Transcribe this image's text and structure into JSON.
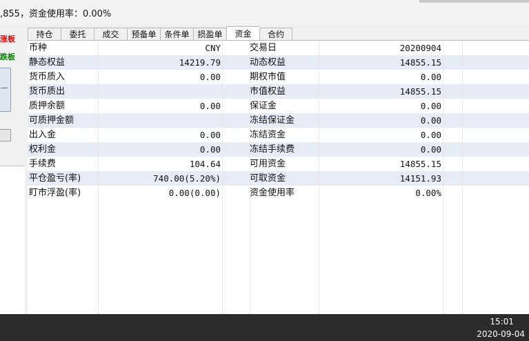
{
  "topbar": {
    "summary": ",855，资金使用率：0.00%"
  },
  "leftpanel": {
    "limit_up_label": "涨板",
    "limit_down_label": "跌板"
  },
  "tabs": [
    {
      "label": "持仓"
    },
    {
      "label": "委托"
    },
    {
      "label": "成交"
    },
    {
      "label": "预备单"
    },
    {
      "label": "条件单"
    },
    {
      "label": "损盈单"
    },
    {
      "label": "资金",
      "active": true
    },
    {
      "label": "合约"
    }
  ],
  "funds": {
    "rows": [
      {
        "label1": "币种",
        "value1": "CNY",
        "label2": "交易日",
        "value2": "20200904"
      },
      {
        "label1": "静态权益",
        "value1": "14219.79",
        "label2": "动态权益",
        "value2": "14855.15"
      },
      {
        "label1": "货币质入",
        "value1": "0.00",
        "label2": "期权市值",
        "value2": "0.00"
      },
      {
        "label1": "货币质出",
        "value1": "",
        "label2": "市值权益",
        "value2": "14855.15"
      },
      {
        "label1": "质押余额",
        "value1": "0.00",
        "label2": "保证金",
        "value2": "0.00"
      },
      {
        "label1": "可质押金额",
        "value1": "",
        "label2": "冻结保证金",
        "value2": "0.00"
      },
      {
        "label1": "出入金",
        "value1": "0.00",
        "label2": "冻结资金",
        "value2": "0.00"
      },
      {
        "label1": "权利金",
        "value1": "0.00",
        "label2": "冻结手续费",
        "value2": "0.00"
      },
      {
        "label1": "手续费",
        "value1": "104.64",
        "label2": "可用资金",
        "value2": "14855.15"
      },
      {
        "label1": "平仓盈亏(率)",
        "value1": "740.00(5.20%)",
        "label2": "可取资金",
        "value2": "14151.93"
      },
      {
        "label1": "盯市浮盈(率)",
        "value1": "0.00(0.00)",
        "label2": "资金使用率",
        "value2": "0.00%"
      }
    ]
  },
  "taskbar": {
    "time": "15:01",
    "date": "2020-09-04"
  },
  "colors": {
    "limit_up": "#e00000",
    "limit_down": "#008000",
    "row_alt": "#e6ebf5",
    "taskbar": "#2b2b2b"
  }
}
